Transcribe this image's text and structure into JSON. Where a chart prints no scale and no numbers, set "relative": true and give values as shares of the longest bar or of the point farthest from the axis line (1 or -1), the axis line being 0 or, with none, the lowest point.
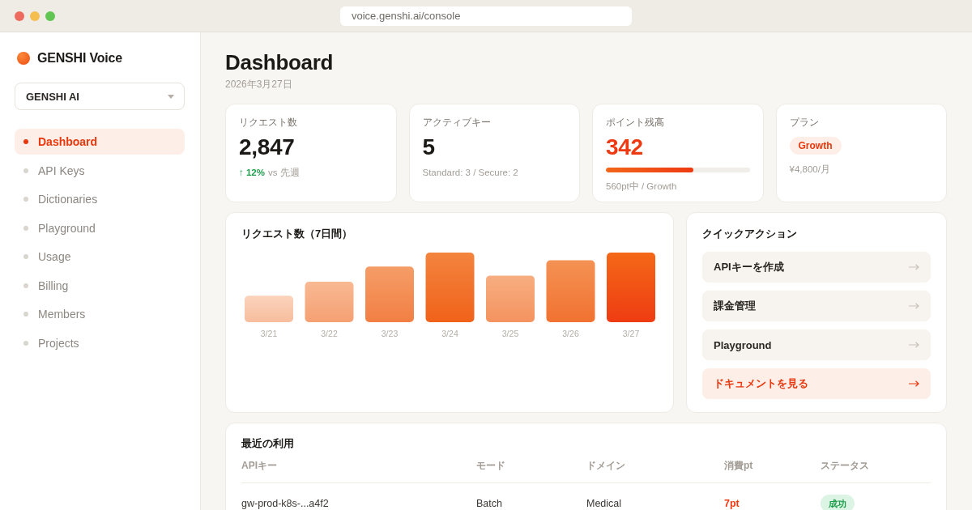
{
  "browser": {
    "url": "voice.genshi.ai/console"
  },
  "sidebar": {
    "brand": "GENSHI Voice",
    "workspace": "GENSHI AI",
    "items": [
      {
        "label": "Dashboard",
        "selected": true
      },
      {
        "label": "API Keys",
        "selected": false
      },
      {
        "label": "Dictionaries",
        "selected": false
      },
      {
        "label": "Playground",
        "selected": false
      },
      {
        "label": "Usage",
        "selected": false
      },
      {
        "label": "Billing",
        "selected": false
      },
      {
        "label": "Members",
        "selected": false
      },
      {
        "label": "Projects",
        "selected": false
      }
    ]
  },
  "header": {
    "title": "Dashboard",
    "date": "2026年3月27日"
  },
  "stats": [
    {
      "kind": "trend",
      "label": "リクエスト数",
      "value": "2,847",
      "change": "↑ 12%",
      "caption": "vs 先週"
    },
    {
      "kind": "plain",
      "label": "アクティブキー",
      "value": "5",
      "caption": "Standard: 3 / Secure: 2"
    },
    {
      "kind": "meter",
      "label": "ポイント残高",
      "value": "342",
      "level": 0.61,
      "caption": "560pt中 / Growth"
    },
    {
      "kind": "plan",
      "label": "プラン",
      "badge": "Growth",
      "caption": "¥4,800/月"
    }
  ],
  "chart": {
    "chart_data": {
      "type": "bar",
      "relative": true,
      "title": "リクエスト数（7日間）",
      "categories": [
        "3/21",
        "3/22",
        "3/23",
        "3/24",
        "3/25",
        "3/26",
        "3/27"
      ],
      "values": [
        0.38,
        0.58,
        0.8,
        1,
        0.67,
        0.89,
        1
      ]
    }
  },
  "quick_actions": {
    "title": "クイックアクション",
    "items": [
      {
        "label": "APIキーを作成",
        "kind": "default"
      },
      {
        "label": "課金管理",
        "kind": "default"
      },
      {
        "label": "Playground",
        "kind": "default"
      },
      {
        "label": "ドキュメントを見る",
        "kind": "primary"
      }
    ]
  },
  "recent_usage": {
    "title": "最近の利用",
    "columns": [
      "APIキー",
      "モード",
      "ドメイン",
      "消費pt",
      "ステータス"
    ],
    "rows": [
      {
        "api_key": "gw-prod-k8s-...a4f2",
        "mode": "Batch",
        "domain": "Medical",
        "points": "7pt",
        "status": {
          "label": "成功",
          "kind": "success"
        }
      }
    ]
  }
}
